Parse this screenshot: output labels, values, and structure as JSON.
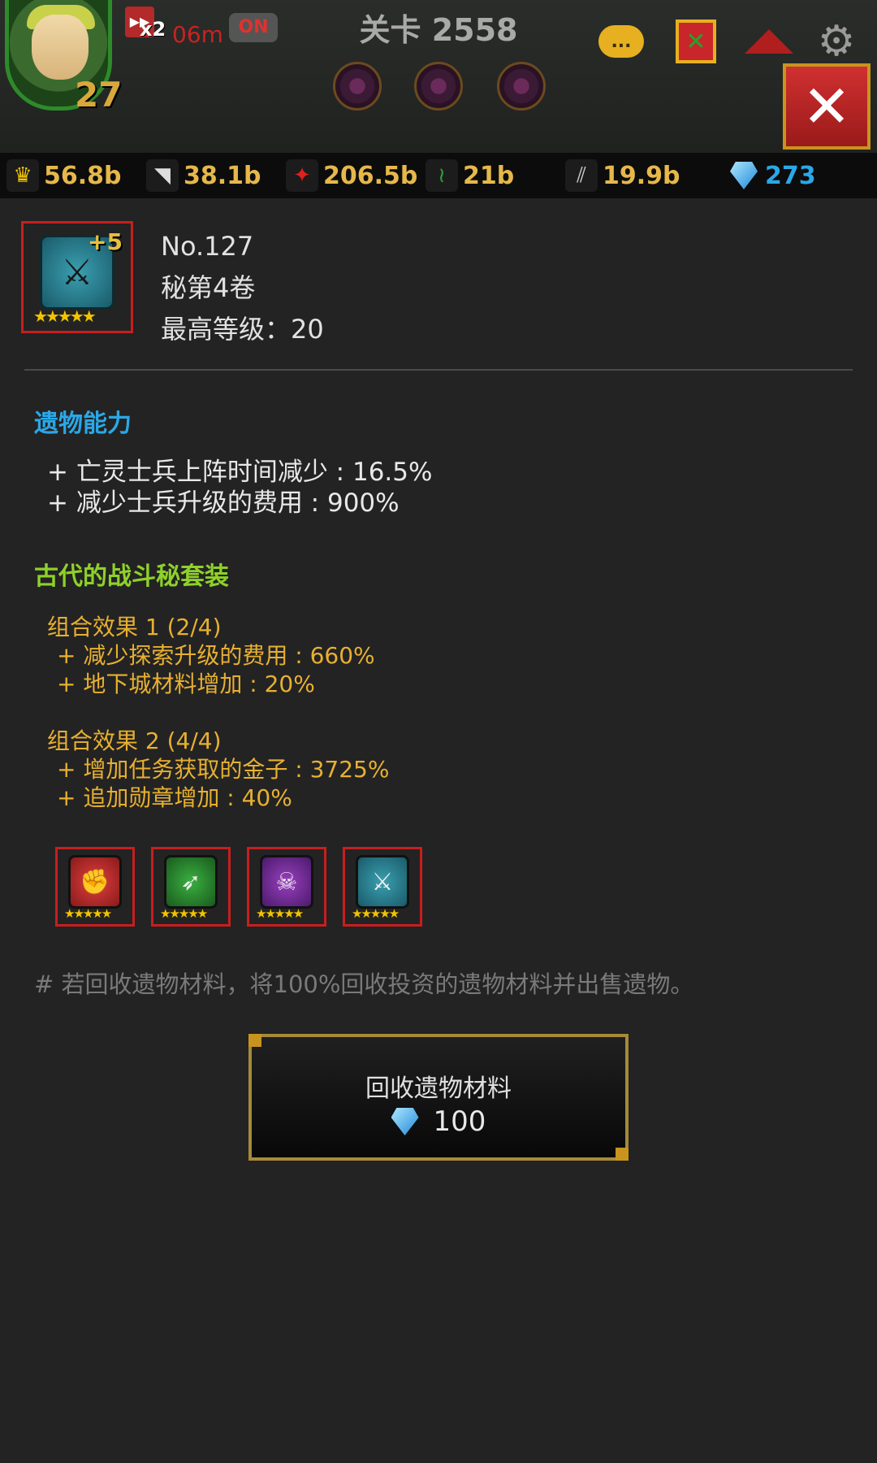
{
  "hud": {
    "player_level": "27",
    "speed_multiplier": "x2",
    "speed_timer": "06m",
    "auto_toggle": "ON",
    "stage_title": "关卡 2558",
    "chat_label": "...",
    "close_label": "✕"
  },
  "resources": [
    {
      "icon": "crown-icon",
      "glyph": "♛",
      "value": "56.8b"
    },
    {
      "icon": "tooth-icon",
      "glyph": "◥",
      "value": "38.1b"
    },
    {
      "icon": "red-crystal-icon",
      "glyph": "✦",
      "value": "206.5b"
    },
    {
      "icon": "vine-icon",
      "glyph": "≀",
      "value": "21b"
    },
    {
      "icon": "claw-icon",
      "glyph": "⫽",
      "value": "19.9b"
    },
    {
      "icon": "diamond-icon",
      "glyph": "",
      "value": "273"
    }
  ],
  "relic": {
    "plus_level": "+5",
    "stars": "★★★★★",
    "number": "No.127",
    "name": "秘第4卷",
    "max_level": "最高等级：20"
  },
  "ability": {
    "title": "遗物能力",
    "lines": [
      "+ 亡灵士兵上阵时间减少 : 16.5%",
      "+ 减少士兵升级的费用 : 900%"
    ]
  },
  "set": {
    "title": "古代的战斗秘套装",
    "effects": [
      {
        "head": "组合效果 1 (2/4)",
        "lines": [
          "+ 减少探索升级的费用 : 660%",
          "+ 地下城材料增加 : 20%"
        ]
      },
      {
        "head": "组合效果 2 (4/4)",
        "lines": [
          "+ 增加任务获取的金子 : 3725%",
          "+ 追加勋章增加 : 40%"
        ]
      }
    ],
    "items": [
      {
        "icon": "sword-fist-icon",
        "glyph": "✊",
        "color": "#c02828",
        "stars": "★★★★★"
      },
      {
        "icon": "arrows-icon",
        "glyph": "➶",
        "color": "#2a8a32",
        "stars": "★★★★★"
      },
      {
        "icon": "skull-icon",
        "glyph": "☠",
        "color": "#7a2aa0",
        "stars": "★★★★★"
      },
      {
        "icon": "crossed-axes-icon",
        "glyph": "⚔",
        "color": "#2a8aa0",
        "stars": "★★★★★"
      }
    ]
  },
  "note": "# 若回收遗物材料，将100%回收投资的遗物材料并出售遗物。",
  "recycle": {
    "label": "回收遗物材料",
    "cost": "100"
  },
  "colors": {
    "accent_blue": "#2aa8e8",
    "set_green": "#8ed12a",
    "set_gold": "#e8b030",
    "frame_red": "#c81e1e"
  }
}
